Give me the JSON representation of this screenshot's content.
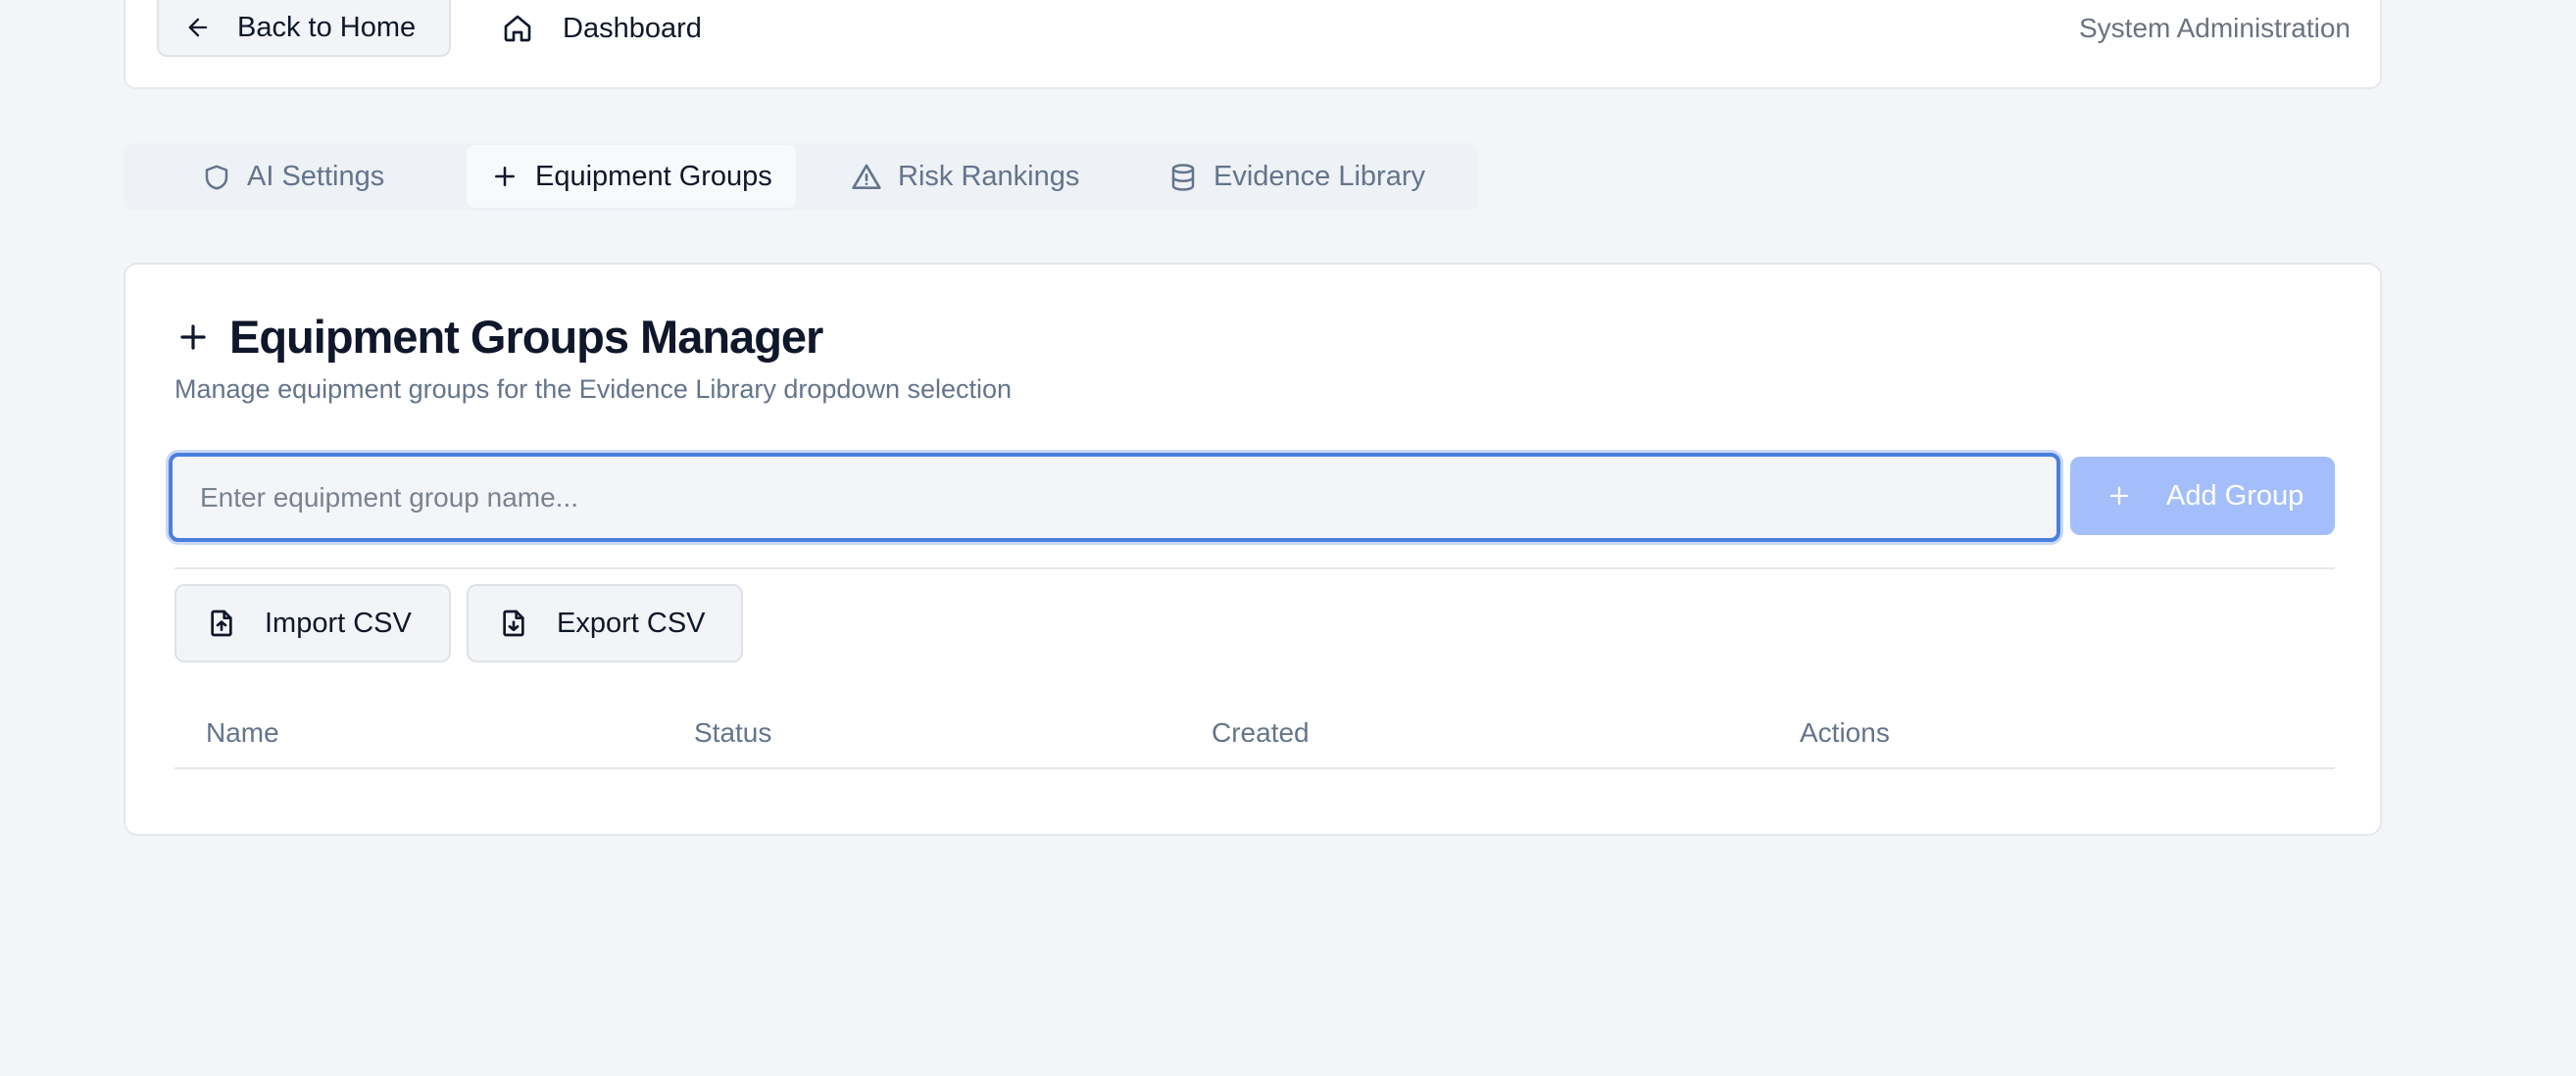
{
  "header": {
    "back_label": "Back to Home",
    "dashboard_label": "Dashboard",
    "section_label": "System Administration"
  },
  "tabs": [
    {
      "label": "AI Settings",
      "icon": "shield-icon",
      "active": false
    },
    {
      "label": "Equipment Groups",
      "icon": "plus-icon",
      "active": true
    },
    {
      "label": "Risk Rankings",
      "icon": "warning-triangle-icon",
      "active": false
    },
    {
      "label": "Evidence Library",
      "icon": "database-icon",
      "active": false
    }
  ],
  "manager": {
    "title": "Equipment Groups Manager",
    "subtitle": "Manage equipment groups for the Evidence Library dropdown selection",
    "input_value": "",
    "input_placeholder": "Enter equipment group name...",
    "add_label": "Add Group",
    "import_label": "Import CSV",
    "export_label": "Export CSV",
    "columns": [
      "Name",
      "Status",
      "Created",
      "Actions"
    ],
    "rows": []
  },
  "colors": {
    "accent": "#4a7fe0",
    "add_button_disabled": "#a3befa",
    "muted_text": "#64748b",
    "background": "#f4f5f9"
  }
}
